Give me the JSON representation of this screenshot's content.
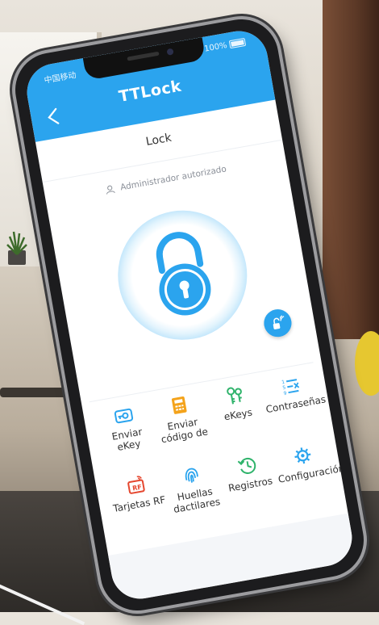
{
  "status_bar": {
    "carrier": "中国移动",
    "battery": "100%"
  },
  "app": {
    "title": "TTLock",
    "lock_name": "Lock"
  },
  "admin": {
    "label": "Administrador autorizado"
  },
  "colors": {
    "primary": "#2ba4ee",
    "orange": "#f4a31b",
    "red": "#e5472f",
    "green": "#2fb36b"
  },
  "menu": [
    {
      "label": "Enviar eKey",
      "icon": "send-ekey-icon",
      "color": "#2ba4ee"
    },
    {
      "label": "Enviar código de",
      "icon": "passcode-calculator-icon",
      "color": "#f4a31b"
    },
    {
      "label": "eKeys",
      "icon": "keys-icon",
      "color": "#2fb36b"
    },
    {
      "label": "Contraseñas",
      "icon": "password-list-icon",
      "color": "#2ba4ee"
    },
    {
      "label": "Tarjetas RF",
      "icon": "rf-card-icon",
      "color": "#e5472f"
    },
    {
      "label": "Huellas dactilares",
      "icon": "fingerprint-icon",
      "color": "#2ba4ee"
    },
    {
      "label": "Registros",
      "icon": "history-icon",
      "color": "#2fb36b"
    },
    {
      "label": "Configuración",
      "icon": "settings-gear-icon",
      "color": "#2ba4ee"
    }
  ]
}
